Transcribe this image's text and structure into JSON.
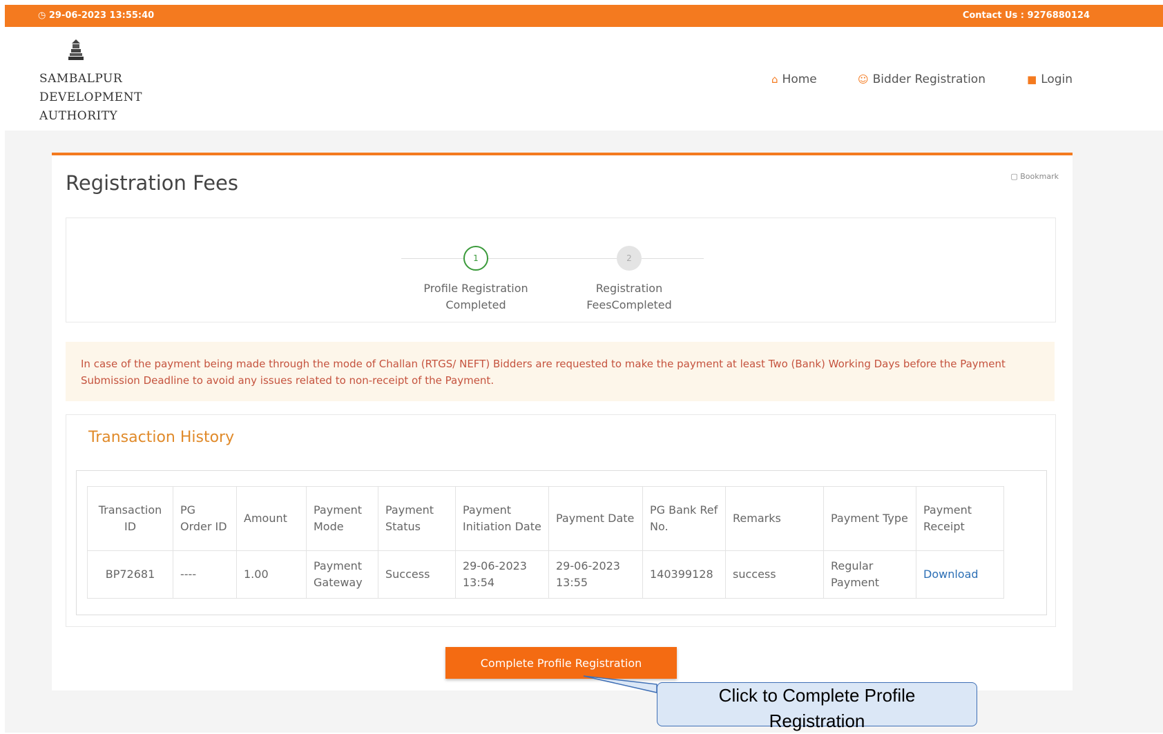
{
  "topbar": {
    "datetime": "◷ 29-06-2023 13:55:40",
    "contact": "Contact Us : 9276880124"
  },
  "brand": {
    "line1": "SAMBALPUR",
    "line2": "DEVELOPMENT",
    "line3": "AUTHORITY"
  },
  "nav": {
    "home": "Home",
    "bidder_registration": "Bidder Registration",
    "login": "Login"
  },
  "page": {
    "title": "Registration Fees",
    "bookmark_label": "Bookmark"
  },
  "stepper": {
    "steps": [
      {
        "number": "1",
        "label_line1": "Profile Registration",
        "label_line2": "Completed"
      },
      {
        "number": "2",
        "label_line1": "Registration",
        "label_line2": "FeesCompleted"
      }
    ]
  },
  "notice": {
    "text": "In case of the payment being made through the mode of Challan (RTGS/ NEFT) Bidders are requested to make the payment at least Two (Bank) Working Days before the Payment Submission Deadline to avoid any issues related to non-receipt of the Payment."
  },
  "transactions": {
    "title": "Transaction History",
    "headers": [
      "Transaction ID",
      "PG Order ID",
      "Amount",
      "Payment Mode",
      "Payment Status",
      "Payment Initiation Date",
      "Payment Date",
      "PG Bank Ref No.",
      "Remarks",
      "Payment Type",
      "Payment Receipt"
    ],
    "rows": [
      {
        "transaction_id": "BP72681",
        "pg_order_id": "----",
        "amount": "1.00",
        "payment_mode": "Payment Gateway",
        "payment_status": "Success",
        "initiation_date": "29-06-2023 13:54",
        "payment_date": "29-06-2023 13:55",
        "pg_bank_ref": "140399128",
        "remarks": "success",
        "payment_type": "Regular Payment",
        "receipt": "Download"
      }
    ]
  },
  "actions": {
    "complete_profile": "Complete Profile Registration"
  },
  "annotation": {
    "callout_line1": "Click to Complete Profile",
    "callout_line2": "Registration"
  },
  "colors": {
    "brand_orange": "#f47a1f",
    "button_orange": "#f46b12",
    "success_green": "#3a9a3a",
    "link_blue": "#2c6fb5",
    "notice_text": "#c5533e"
  }
}
